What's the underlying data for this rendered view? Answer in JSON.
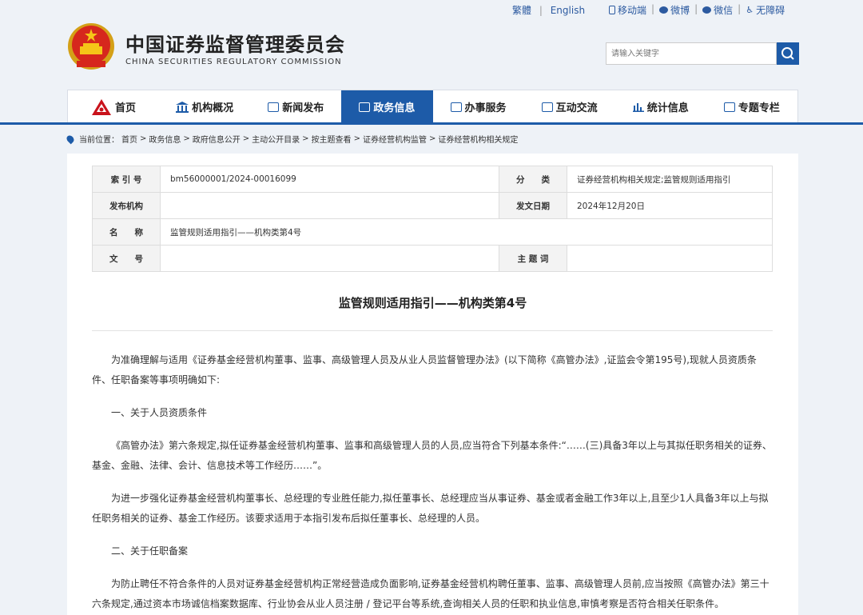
{
  "topbar": {
    "lang_cn": "繁體",
    "lang_sep": "|",
    "lang_en": "English",
    "mobile": "移动端",
    "weibo": "微博",
    "wechat": "微信",
    "accessible": "无障碍",
    "sep": "|"
  },
  "header": {
    "title_cn": "中国证券监督管理委员会",
    "title_en": "CHINA SECURITIES REGULATORY COMMISSION",
    "search_placeholder": "请输入关键字"
  },
  "nav": [
    {
      "label": "首页",
      "icon": "csrc-logo-icon"
    },
    {
      "label": "机构概况",
      "icon": "building-icon"
    },
    {
      "label": "新闻发布",
      "icon": "news-icon"
    },
    {
      "label": "政务信息",
      "icon": "monitor-icon",
      "active": true
    },
    {
      "label": "办事服务",
      "icon": "list-icon"
    },
    {
      "label": "互动交流",
      "icon": "chat-icon"
    },
    {
      "label": "统计信息",
      "icon": "bar-chart-icon"
    },
    {
      "label": "专题专栏",
      "icon": "document-icon"
    }
  ],
  "breadcrumb": {
    "prefix": "当前位置：",
    "items": [
      "首页",
      "政务信息",
      "政府信息公开",
      "主动公开目录",
      "按主题查看",
      "证券经营机构监管",
      "证券经营机构相关规定"
    ],
    "sep": ">"
  },
  "meta": {
    "index_label": "索 引 号",
    "index_value": "bm56000001/2024-00016099",
    "category_label": "分　　类",
    "category_value": "证券经营机构相关规定;监管规则适用指引",
    "issuer_label": "发布机构",
    "issuer_value": "",
    "date_label": "发文日期",
    "date_value": "2024年12月20日",
    "name_label": "名　　称",
    "name_value": "监管规则适用指引——机构类第4号",
    "docno_label": "文　　号",
    "docno_value": "",
    "keyword_label": "主 题 词",
    "keyword_value": ""
  },
  "document": {
    "title": "监管规则适用指引——机构类第4号",
    "paragraphs": [
      "为准确理解与适用《证券基金经营机构董事、监事、高级管理人员及从业人员监督管理办法》(以下简称《高管办法》,证监会令第195号),现就人员资质条件、任职备案等事项明确如下:",
      "一、关于人员资质条件",
      "《高管办法》第六条规定,拟任证券基金经营机构董事、监事和高级管理人员的人员,应当符合下列基本条件:“……(三)具备3年以上与其拟任职务相关的证券、基金、金融、法律、会计、信息技术等工作经历……”。",
      "为进一步强化证券基金经营机构董事长、总经理的专业胜任能力,拟任董事长、总经理应当从事证券、基金或者金融工作3年以上,且至少1人具备3年以上与拟任职务相关的证券、基金工作经历。该要求适用于本指引发布后拟任董事长、总经理的人员。",
      "二、关于任职备案",
      "为防止聘任不符合条件的人员对证券基金经营机构正常经营造成负面影响,证券基金经营机构聘任董事、监事、高级管理人员前,应当按照《高管办法》第三十六条规定,通过资本市场诚信档案数据库、行业协会从业人员注册 / 登记平台等系统,查询相关人员的任职和执业信息,审慎考察是否符合相关任职条件。"
    ]
  },
  "colors": {
    "brand_blue": "#1d5ba8",
    "logo_red": "#c9121b",
    "page_bg": "#eef2f7"
  }
}
